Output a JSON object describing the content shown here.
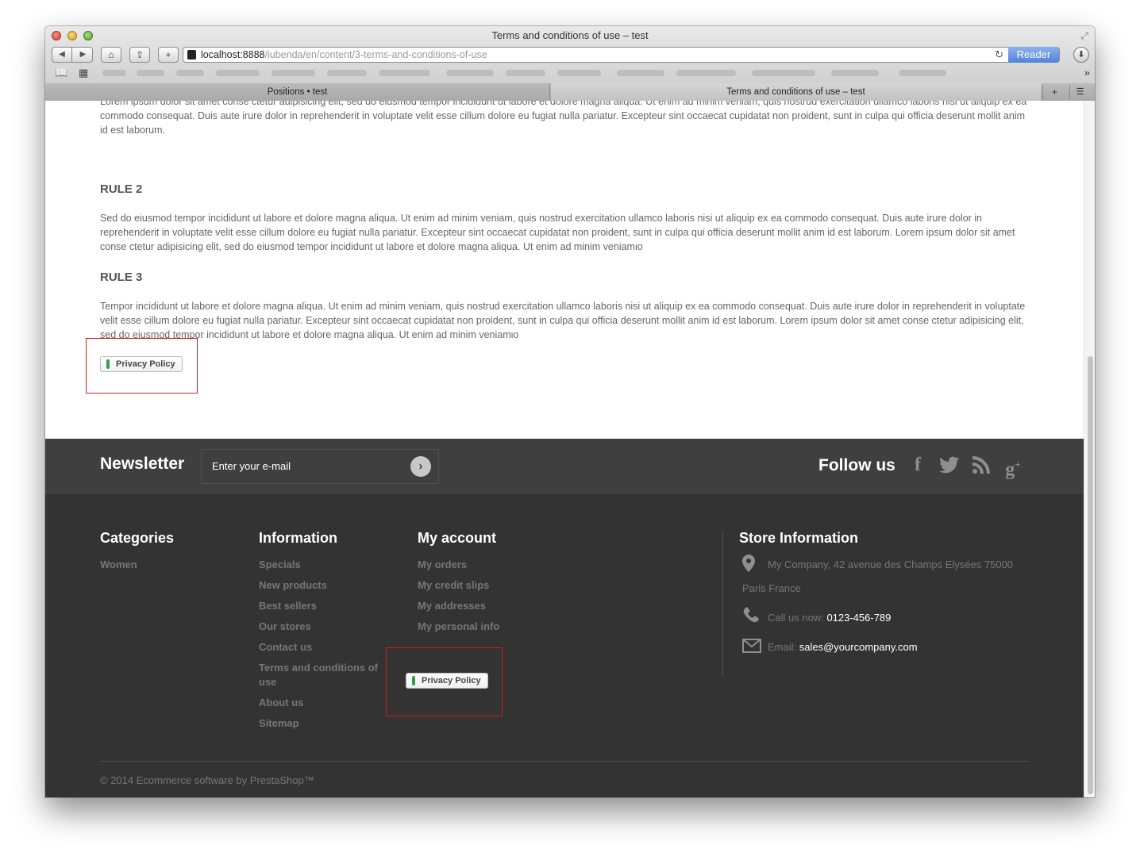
{
  "window": {
    "title": "Terms and conditions of use – test",
    "url_host": "localhost:8888",
    "url_path": "/iubenda/en/content/3-terms-and-conditions-of-use",
    "reader_label": "Reader",
    "tabs": [
      {
        "label": "Positions • test"
      },
      {
        "label": "Terms and conditions of use – test"
      }
    ]
  },
  "page": {
    "intro_text": "Lorem ipsum dolor sit amet conse ctetur adipisicing elit, sed do eiusmod tempor incididunt ut labore et dolore magna aliqua. Ut enim ad minim veniam, quis nostrud exercitation ullamco laboris nisi ut aliquip ex ea commodo consequat. Duis aute irure dolor in reprehenderit in voluptate velit esse cillum dolore eu fugiat nulla pariatur. Excepteur sint occaecat cupidatat non proident, sunt in culpa qui officia deserunt mollit anim id est laborum.",
    "rule2_heading": "RULE 2",
    "rule2_text": "Sed do eiusmod tempor incididunt ut labore et dolore magna aliqua. Ut enim ad minim veniam, quis nostrud exercitation ullamco laboris nisi ut aliquip ex ea commodo consequat. Duis aute irure dolor in reprehenderit in voluptate velit esse cillum dolore eu fugiat nulla pariatur. Excepteur sint occaecat cupidatat non proident, sunt in culpa qui officia deserunt mollit anim id est laborum. Lorem ipsum dolor sit amet conse ctetur adipisicing elit, sed do eiusmod tempor incididunt ut labore et dolore magna aliqua. Ut enim ad minim veniamιo",
    "rule3_heading": "RULE 3",
    "rule3_text": "Tempor incididunt ut labore et dolore magna aliqua. Ut enim ad minim veniam, quis nostrud exercitation ullamco laboris nisi ut aliquip ex ea commodo consequat. Duis aute irure dolor in reprehenderit in voluptate velit esse cillum dolore eu fugiat nulla pariatur. Excepteur sint occaecat cupidatat non proident, sunt in culpa qui officia deserunt mollit anim id est laborum. Lorem ipsum dolor sit amet conse ctetur adipisicing elit, sed do eiusmod tempor incididunt ut labore et dolore magna aliqua. Ut enim ad minim veniamιo",
    "privacy_button": "Privacy Policy"
  },
  "newsletter": {
    "title": "Newsletter",
    "placeholder": "Enter your e-mail",
    "follow_title": "Follow us"
  },
  "footer": {
    "categories": {
      "title": "Categories",
      "items": [
        "Women"
      ]
    },
    "information": {
      "title": "Information",
      "items": [
        "Specials",
        "New products",
        "Best sellers",
        "Our stores",
        "Contact us",
        "Terms and conditions of use",
        "About us",
        "Sitemap"
      ]
    },
    "account": {
      "title": "My account",
      "items": [
        "My orders",
        "My credit slips",
        "My addresses",
        "My personal info"
      ]
    },
    "privacy_button": "Privacy Policy",
    "store": {
      "title": "Store Information",
      "address_line1": "My Company, 42 avenue des Champs Elysées 75000",
      "address_line2": "Paris France",
      "call_label": "Call us now:",
      "phone": "0123-456-789",
      "email_label": "Email:",
      "email": "sales@yourcompany.com"
    },
    "copyright": "© 2014 Ecommerce software by PrestaShop™"
  }
}
